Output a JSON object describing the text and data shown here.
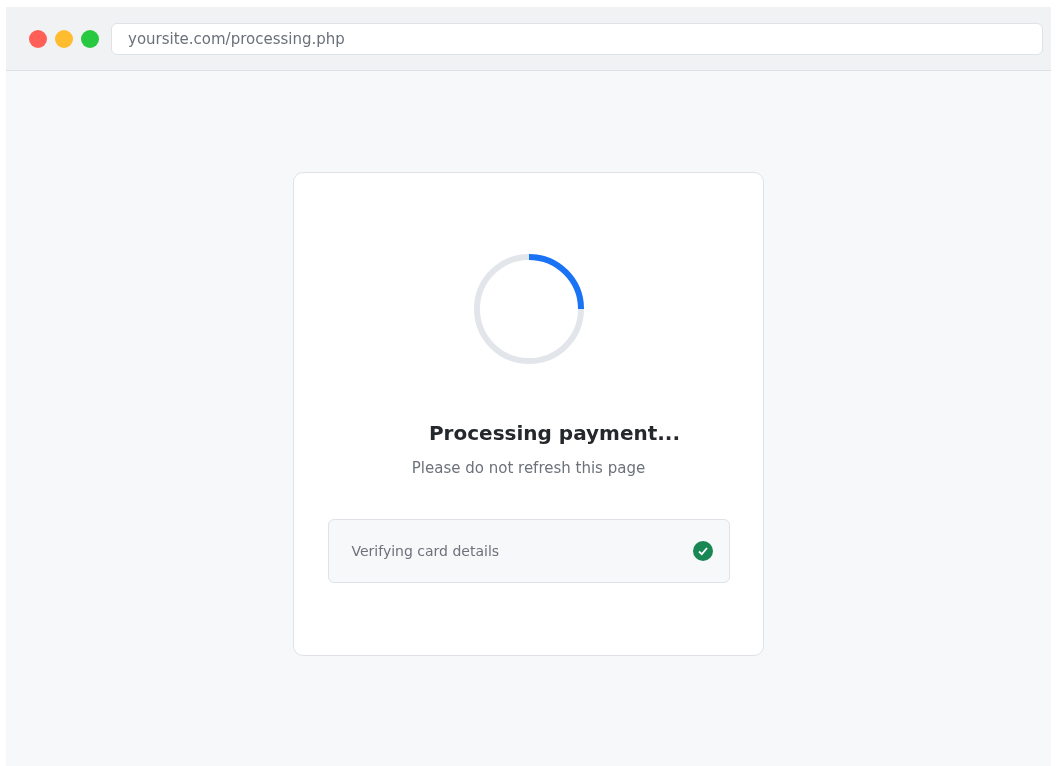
{
  "browser": {
    "url": "yoursite.com/processing.php"
  },
  "card": {
    "title": "Processing payment...",
    "subtitle": "Please do not refresh this page",
    "steps": [
      {
        "label": "Verifying card details",
        "done": true
      }
    ]
  }
}
